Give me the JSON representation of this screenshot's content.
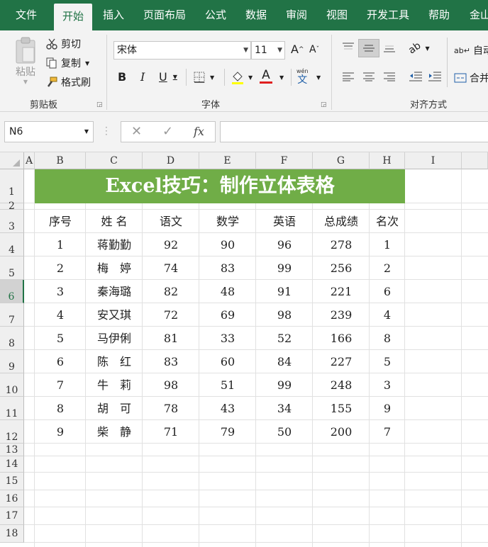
{
  "tabs": [
    "文件",
    "开始",
    "插入",
    "页面布局",
    "公式",
    "数据",
    "审阅",
    "视图",
    "开发工具",
    "帮助",
    "金山"
  ],
  "active_tab": "开始",
  "ribbon": {
    "paste": "粘贴",
    "cut": "剪切",
    "copy": "复制",
    "format_painter": "格式刷",
    "clipboard_group": "剪贴板",
    "font_name": "宋体",
    "font_size": "11",
    "font_group": "字体",
    "wrap_text": "自动",
    "merge": "合并",
    "align_group": "对齐方式",
    "bold": "B",
    "italic": "I",
    "underline": "U",
    "grow_font": "A",
    "shrink_font": "A",
    "font_color": "A",
    "phonetic": "文"
  },
  "formula_bar": {
    "name_box": "N6",
    "fx": "fx",
    "formula": ""
  },
  "columns": [
    "A",
    "B",
    "C",
    "D",
    "E",
    "F",
    "G",
    "H",
    "I"
  ],
  "rows": [
    "1",
    "2",
    "3",
    "4",
    "5",
    "6",
    "7",
    "8",
    "9",
    "10",
    "11",
    "12",
    "13",
    "14",
    "15",
    "16",
    "17",
    "18"
  ],
  "selected_row": "6",
  "sheet": {
    "title": "Excel技巧：制作立体表格",
    "headers": [
      "序号",
      "姓 名",
      "语文",
      "数学",
      "英语",
      "总成绩",
      "名次"
    ],
    "data": [
      [
        "1",
        "蒋勤勤",
        "92",
        "90",
        "96",
        "278",
        "1"
      ],
      [
        "2",
        "梅　婷",
        "74",
        "83",
        "99",
        "256",
        "2"
      ],
      [
        "3",
        "秦海璐",
        "82",
        "48",
        "91",
        "221",
        "6"
      ],
      [
        "4",
        "安又琪",
        "72",
        "69",
        "98",
        "239",
        "4"
      ],
      [
        "5",
        "马伊俐",
        "81",
        "33",
        "52",
        "166",
        "8"
      ],
      [
        "6",
        "陈　红",
        "83",
        "60",
        "84",
        "227",
        "5"
      ],
      [
        "7",
        "牛　莉",
        "98",
        "51",
        "99",
        "248",
        "3"
      ],
      [
        "8",
        "胡　可",
        "78",
        "43",
        "34",
        "155",
        "9"
      ],
      [
        "9",
        "柴　静",
        "71",
        "79",
        "50",
        "200",
        "7"
      ]
    ]
  },
  "colors": {
    "excel_green": "#217346",
    "title_fill": "#70ad47"
  }
}
